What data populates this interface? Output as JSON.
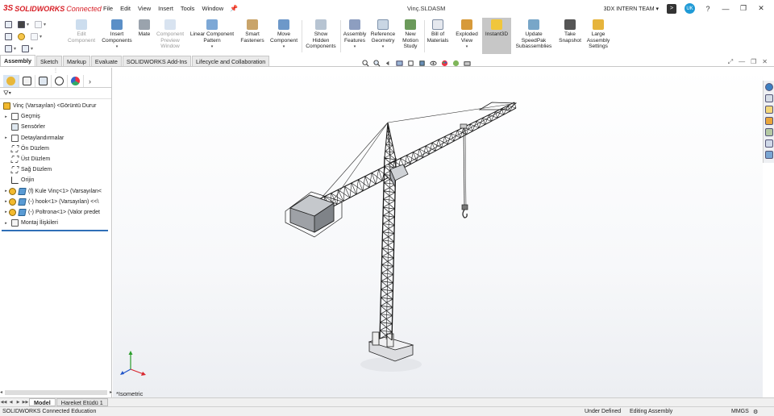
{
  "app": {
    "brand_ds": "3S",
    "brand_name": "SOLIDWORKS",
    "brand_suffix": "Connected",
    "document_title": "Vinç.SLDASM"
  },
  "menu": [
    "File",
    "Edit",
    "View",
    "Insert",
    "Tools",
    "Window"
  ],
  "account": {
    "team": "3DX INTERN TEAM ▾",
    "avatar_initials": "UK"
  },
  "ribbon": {
    "edit_component": [
      "Edit",
      "Component"
    ],
    "insert_components": [
      "Insert",
      "Components"
    ],
    "mate": [
      "Mate"
    ],
    "component_preview": [
      "Component",
      "Preview",
      "Window"
    ],
    "linear_pattern": [
      "Linear Component",
      "Pattern"
    ],
    "smart_fasteners": [
      "Smart",
      "Fasteners"
    ],
    "move_component": [
      "Move",
      "Component"
    ],
    "show_hidden": [
      "Show",
      "Hidden",
      "Components"
    ],
    "assembly_features": [
      "Assembly",
      "Features"
    ],
    "reference_geometry": [
      "Reference",
      "Geometry"
    ],
    "new_motion_study": [
      "New",
      "Motion",
      "Study"
    ],
    "bill_of_materials": [
      "Bill of",
      "Materials"
    ],
    "exploded_view": [
      "Exploded",
      "View"
    ],
    "instant3d": [
      "Instant3D"
    ],
    "update_speedpak": [
      "Update",
      "SpeedPak",
      "Subassemblies"
    ],
    "take_snapshot": [
      "Take",
      "Snapshot"
    ],
    "large_assembly": [
      "Large",
      "Assembly",
      "Settings"
    ]
  },
  "tabs": [
    "Assembly",
    "Sketch",
    "Markup",
    "Evaluate",
    "SOLIDWORKS Add-Ins",
    "Lifecycle and Collaboration"
  ],
  "tree": {
    "root": "Vinç (Varsayılan) <Görüntü Durur",
    "items": [
      {
        "label": "Geçmiş",
        "icon": "history-icon",
        "expandable": true
      },
      {
        "label": "Sensörler",
        "icon": "sensor-icon",
        "expandable": false
      },
      {
        "label": "Detaylandırmalar",
        "icon": "annotation-icon",
        "expandable": true
      },
      {
        "label": "Ön Düzlem",
        "icon": "plane-icon",
        "expandable": false
      },
      {
        "label": "Üst Düzlem",
        "icon": "plane-icon",
        "expandable": false
      },
      {
        "label": "Sağ Düzlem",
        "icon": "plane-icon",
        "expandable": false
      },
      {
        "label": "Orijin",
        "icon": "origin-icon",
        "expandable": false
      },
      {
        "label": "(f) Kule Vinç<1> (Varsayılan<",
        "icon": "part-icon",
        "expandable": true
      },
      {
        "label": "(-) hook<1> (Varsayılan) <<\\",
        "icon": "part-icon",
        "expandable": true
      },
      {
        "label": "(-) Poltrona<1> (Valor predet",
        "icon": "part-icon",
        "expandable": true
      },
      {
        "label": "Montaj İlişkileri",
        "icon": "mates-icon",
        "expandable": true
      }
    ]
  },
  "graphics": {
    "orientation": "*Isometric"
  },
  "bottom_tabs": [
    "Model",
    "Hareket Etüdü 1"
  ],
  "status": {
    "left": "SOLIDWORKS Connected Education",
    "defined": "Under Defined",
    "mode": "Editing Assembly",
    "units": "MMGS"
  },
  "colors": {
    "brand": "#d71d24",
    "accent": "#2f6fb7",
    "active_tool": "#c7c7c7"
  }
}
